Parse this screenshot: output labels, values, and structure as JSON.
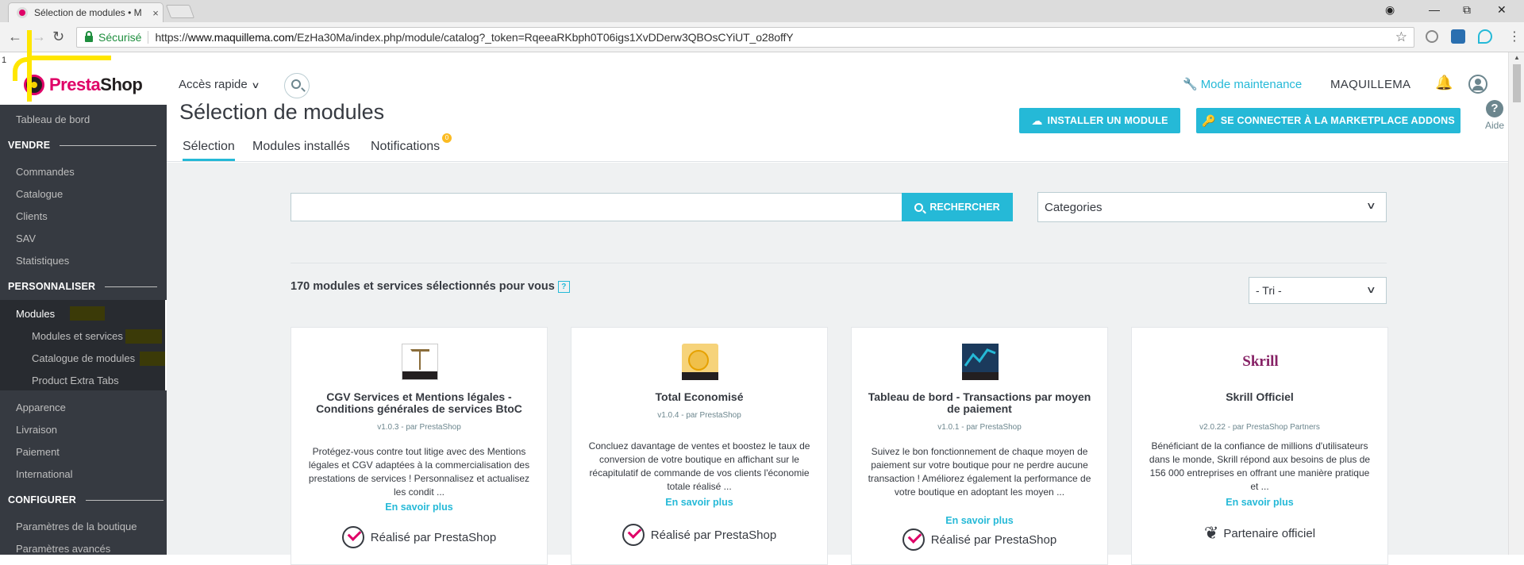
{
  "browser": {
    "tab_title": "Sélection de modules • M",
    "tab_close": "×",
    "secure_label": "Sécurisé",
    "url_scheme": "https://",
    "url_host": "www.maquillema.com",
    "url_path": "/EzHa30Ma/index.php/module/catalog?_token=RqeeaRKbph0T06igs1XvDDerw3QBOsCYiUT_o28offY",
    "annotation_number": "1"
  },
  "header": {
    "logo_presta": "Presta",
    "logo_shop": "Shop",
    "quick_access": "Accès rapide",
    "maintenance": "Mode maintenance",
    "shop_name": "MAQUILLEMA",
    "help": "Aide"
  },
  "sidebar": {
    "dashboard": "Tableau de bord",
    "section_sell": "VENDRE",
    "orders": "Commandes",
    "catalog": "Catalogue",
    "customers": "Clients",
    "sav": "SAV",
    "stats": "Statistiques",
    "section_customize": "PERSONNALISER",
    "modules": "Modules",
    "modules_services": "Modules et services",
    "modules_catalog": "Catalogue de modules",
    "extra_tabs": "Product Extra Tabs",
    "appearance": "Apparence",
    "shipping": "Livraison",
    "payment": "Paiement",
    "international": "International",
    "section_configure": "CONFIGURER",
    "shop_params": "Paramètres de la boutique",
    "advanced_params": "Paramètres avancés"
  },
  "page": {
    "title": "Sélection de modules",
    "tabs": [
      "Sélection",
      "Modules installés",
      "Notifications"
    ],
    "notif_badge": "0",
    "install_btn": "INSTALLER UN MODULE",
    "marketplace_btn": "SE CONNECTER À LA MARKETPLACE ADDONS"
  },
  "main": {
    "search_placeholder": "",
    "search_btn": "RECHERCHER",
    "categories": "Categories",
    "count_text": "170 modules et services sélectionnés pour vous",
    "count_help": "?",
    "sort": "- Tri -"
  },
  "cards": [
    {
      "title": "CGV Services et Mentions légales - Conditions générales de services BtoC",
      "version": "v1.0.3 - par PrestaShop",
      "desc": "Protégez-vous contre tout litige avec des Mentions légales et CGV adaptées à la commercialisation des prestations de services ! Personnalisez et actualisez les condit ...",
      "more": "En savoir plus",
      "by": "Réalisé par PrestaShop"
    },
    {
      "title": "Total Economisé",
      "version": "v1.0.4 - par PrestaShop",
      "desc": "Concluez davantage de ventes et boostez le taux de conversion de votre boutique en affichant sur le récapitulatif de commande de vos clients l'économie totale réalisé ...",
      "more": "En savoir plus",
      "by": "Réalisé par PrestaShop"
    },
    {
      "title": "Tableau de bord - Transactions par moyen de paiement",
      "version": "v1.0.1 - par PrestaShop",
      "desc": "Suivez le bon fonctionnement de chaque moyen de paiement sur votre boutique pour ne perdre aucune transaction ! Améliorez également la performance de votre boutique en adoptant les moyen ...",
      "more": "En savoir plus",
      "by": "Réalisé par PrestaShop"
    },
    {
      "title": "Skrill Officiel",
      "logo_text": "Skrill",
      "version": "v2.0.22 - par PrestaShop Partners",
      "desc": "Bénéficiant de la confiance de millions d'utilisateurs dans le monde, Skrill répond aux besoins de plus de 156 000 entreprises en offrant une manière pratique et ...",
      "more": "En savoir plus",
      "by": "Partenaire officiel"
    }
  ],
  "colors": {
    "accent": "#25b9d7",
    "sidebar": "#363a41",
    "brand_pink": "#df0067",
    "annotation": "#ffe600"
  }
}
